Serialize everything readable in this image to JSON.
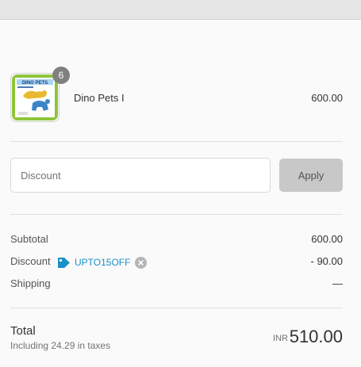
{
  "product": {
    "name": "Dino Pets I",
    "price": "600.00",
    "quantity": "6",
    "thumbnail_label": "DINO PETS"
  },
  "discount": {
    "placeholder": "Discount",
    "apply_label": "Apply"
  },
  "summary": {
    "subtotal_label": "Subtotal",
    "subtotal_value": "600.00",
    "discount_label": "Discount",
    "discount_code": "UPTO15OFF",
    "discount_value": "- 90.00",
    "shipping_label": "Shipping",
    "shipping_value": "—"
  },
  "total": {
    "label": "Total",
    "taxes_note": "Including 24.29 in taxes",
    "currency": "INR",
    "amount": "510.00"
  },
  "colors": {
    "accent": "#1990c6",
    "apply_bg": "#c8c8c8",
    "thumbnail_frame": "#8fc43a"
  }
}
